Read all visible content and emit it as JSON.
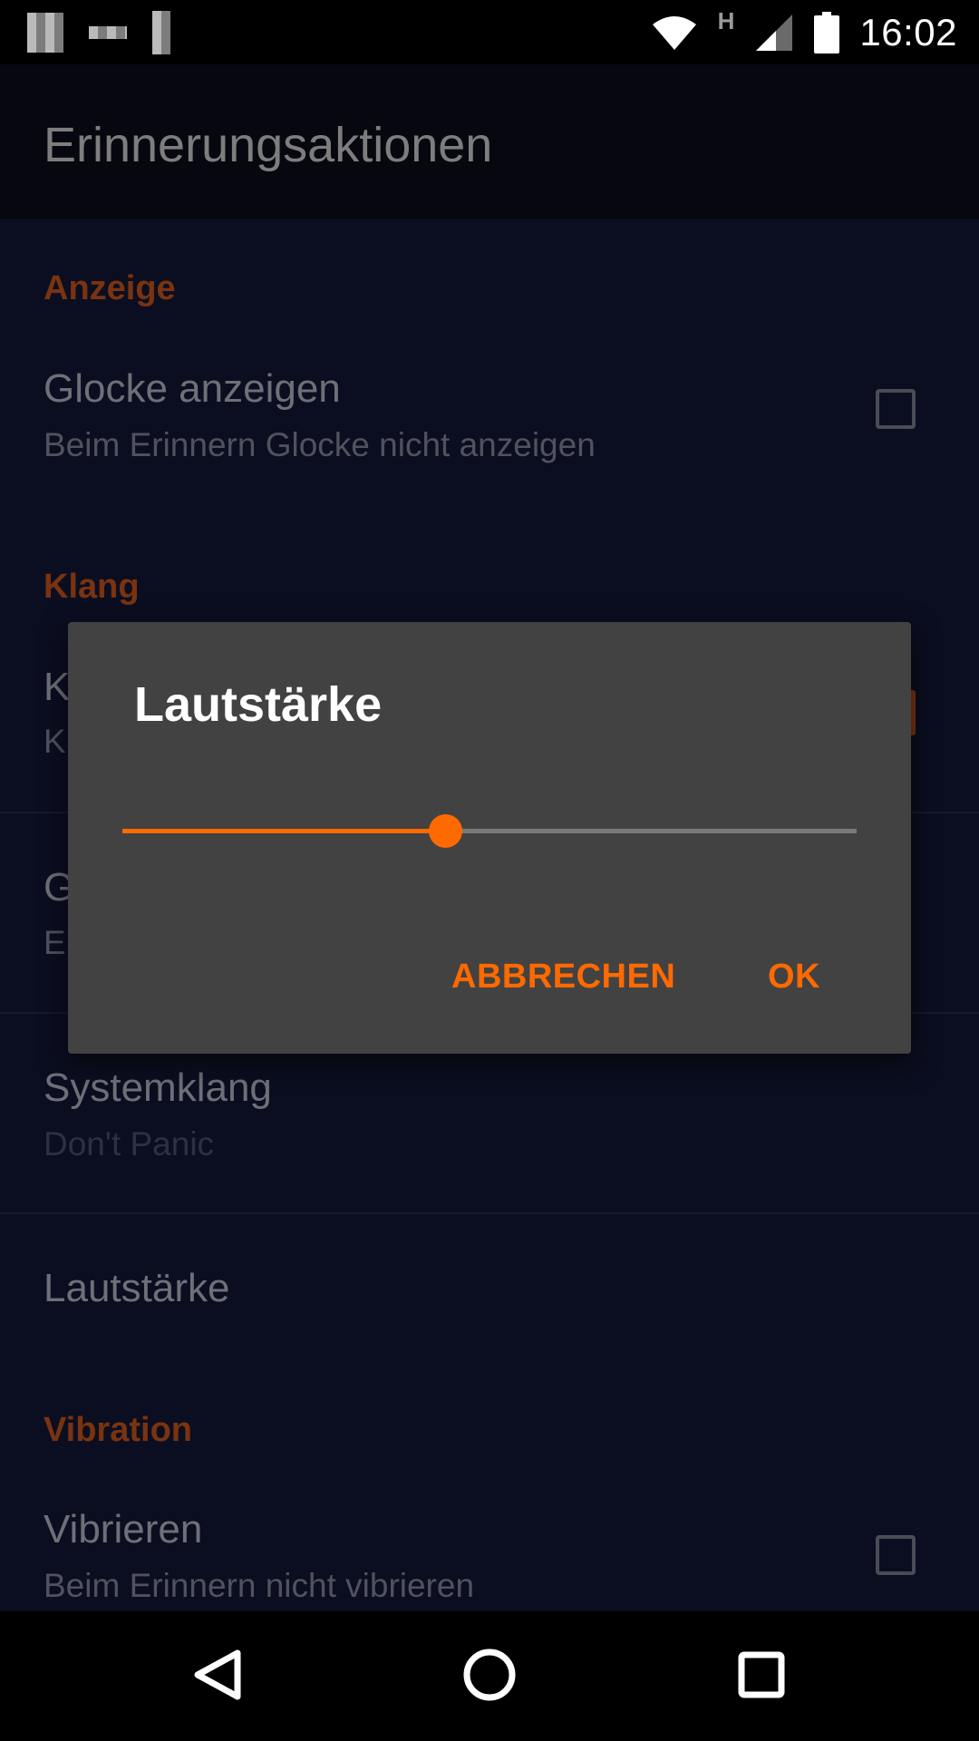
{
  "status_bar": {
    "time": "16:02",
    "network_type": "H",
    "icons": [
      "notification-icon",
      "notification-icon",
      "notification-icon",
      "wifi-icon",
      "cell-signal-icon",
      "battery-icon"
    ]
  },
  "toolbar": {
    "title": "Erinnerungsaktionen"
  },
  "sections": {
    "display": {
      "header": "Anzeige",
      "bell": {
        "title": "Glocke anzeigen",
        "summary": "Beim Erinnern Glocke nicht anzeigen",
        "checked": false
      }
    },
    "sound": {
      "header": "Klang",
      "item1": {
        "title_visible": "K",
        "summary_visible": "K"
      },
      "item2": {
        "title_visible": "G",
        "summary_visible": "E"
      },
      "system_sound": {
        "title": "Systemklang",
        "summary": "Don't Panic"
      },
      "volume": {
        "title": "Lautstärke"
      }
    },
    "vibration": {
      "header": "Vibration",
      "vibrate": {
        "title": "Vibrieren",
        "summary": "Beim Erinnern nicht vibrieren",
        "checked": false
      }
    }
  },
  "dialog": {
    "title": "Lautstärke",
    "slider_value_fraction": 0.44,
    "cancel_label": "ABBRECHEN",
    "ok_label": "OK"
  },
  "colors": {
    "accent": "#ff6a00",
    "section_header": "#7a3310",
    "background": "#0b0e20",
    "dialog_bg": "#424242"
  },
  "nav_bar": {
    "icons": [
      "back-icon",
      "home-icon",
      "recents-icon"
    ]
  }
}
